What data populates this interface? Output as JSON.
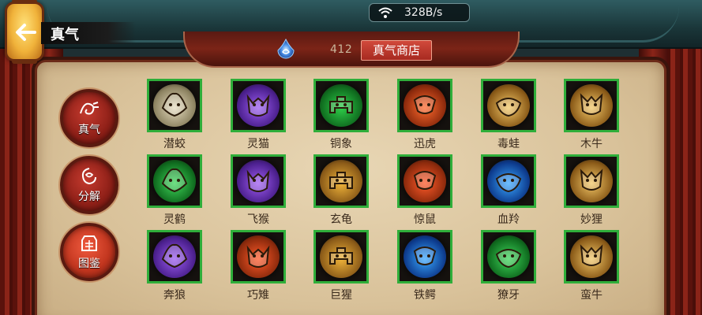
{
  "window": {
    "title": "真气"
  },
  "network": {
    "speed": "328B/s",
    "icon": "wifi-icon"
  },
  "currency": {
    "icon": "spirit-orb-icon",
    "value": "412",
    "shop_label": "真气商店"
  },
  "tabs": [
    {
      "label": "真气",
      "icon": "qi-icon",
      "active": false
    },
    {
      "label": "分解",
      "icon": "decompose-icon",
      "active": false
    },
    {
      "label": "图鉴",
      "icon": "codex-icon",
      "active": true
    }
  ],
  "spirits": [
    {
      "name": "潜蛟",
      "color": "#e6dcc0",
      "glow": "#8c8260"
    },
    {
      "name": "灵猫",
      "color": "#9b5cf0",
      "glow": "#4a1f8c"
    },
    {
      "name": "铜象",
      "color": "#2fcf4a",
      "glow": "#0f6a1e"
    },
    {
      "name": "迅虎",
      "color": "#ff6a2e",
      "glow": "#8c2a0c"
    },
    {
      "name": "毒蛙",
      "color": "#f3c868",
      "glow": "#8a5a18"
    },
    {
      "name": "木牛",
      "color": "#f3c868",
      "glow": "#8a5a18"
    },
    {
      "name": "灵鹤",
      "color": "#3ed65a",
      "glow": "#0f6a1e"
    },
    {
      "name": "飞猴",
      "color": "#a05cf2",
      "glow": "#4a1f8c"
    },
    {
      "name": "玄龟",
      "color": "#f0b43a",
      "glow": "#8a5a18"
    },
    {
      "name": "惊鼠",
      "color": "#ff5a2a",
      "glow": "#8c2a0c"
    },
    {
      "name": "血羚",
      "color": "#3aa8ff",
      "glow": "#0d3a8c"
    },
    {
      "name": "妙狸",
      "color": "#f3c868",
      "glow": "#8a5a18"
    },
    {
      "name": "奔狼",
      "color": "#9b5cf0",
      "glow": "#4a1f8c"
    },
    {
      "name": "巧雉",
      "color": "#ff5a2a",
      "glow": "#8c2a0c"
    },
    {
      "name": "巨猩",
      "color": "#f0b43a",
      "glow": "#8a5a18"
    },
    {
      "name": "铁鳄",
      "color": "#3aa8ff",
      "glow": "#0d3a8c"
    },
    {
      "name": "獠牙",
      "color": "#3ed65a",
      "glow": "#0f6a1e"
    },
    {
      "name": "蛮牛",
      "color": "#f3c868",
      "glow": "#8a5a18"
    }
  ],
  "colors": {
    "card_border": "#2fae3a",
    "shop_button": "#c23a2e",
    "panel": "#dcc59e"
  }
}
